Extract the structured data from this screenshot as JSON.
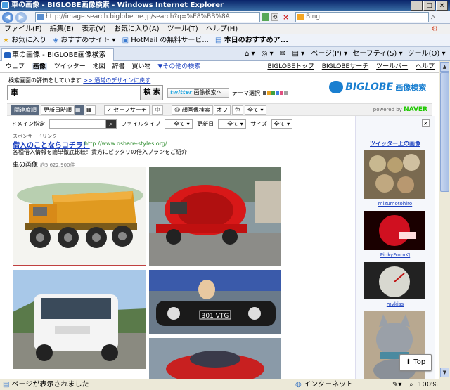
{
  "window": {
    "title": "車の画像 - BIGLOBE画像検索 - Windows Internet Explorer",
    "buttons": [
      "_",
      "□",
      "×"
    ]
  },
  "address": {
    "url": "http://image.search.biglobe.ne.jp/search?q=%E8%BB%8A",
    "search_placeholder": "Bing"
  },
  "menu": [
    "ファイル(F)",
    "編集(E)",
    "表示(V)",
    "お気に入り(A)",
    "ツール(T)",
    "ヘルプ(H)"
  ],
  "favorites": {
    "label": "お気に入り",
    "items": [
      "おすすめサイト ▾",
      "HotMail の無料サービ...",
      "本日のおすすめア..."
    ]
  },
  "tab": {
    "title": "車の画像 - BIGLOBE画像検索",
    "tools": [
      "ページ(P) ▾",
      "セーフティ(S) ▾",
      "ツール(O) ▾"
    ]
  },
  "page": {
    "nav": [
      "ウェブ",
      "画像",
      "ツイッター",
      "地図",
      "辞書",
      "買い物",
      "▼その他の検索"
    ],
    "top_links": [
      "BIGLOBEトップ",
      "BIGLOBEサーチ",
      "ツールバー",
      "ヘルプ"
    ],
    "notice": "検索画面の評価をしています",
    "notice_link": ">> 通常のデザインに戻す",
    "query": "車",
    "search_button": "検 索",
    "twitter_label": "twitter",
    "twitter_suffix": "画像検索へ",
    "theme_label": "テーマ選択",
    "theme_colors": [
      "#555555",
      "#e8a020",
      "#40a040",
      "#4080e0",
      "#e05080",
      "#a0a0a0"
    ],
    "logo": "BIGLOBE",
    "logo_suffix": "画像検索",
    "filters": {
      "relevance": "関連度順",
      "date": "更新日時順",
      "safe": "セーフサーチ",
      "safe_value": "中",
      "face": "顔画像検索",
      "face_value": "オフ",
      "color": "色",
      "color_value": "全て ▾"
    },
    "naver_prefix": "powered by",
    "naver": "NAVER",
    "domain_label": "ドメイン指定",
    "filetype_label": "ファイルタイプ",
    "filetype_value": "全て ▾",
    "updated_label": "更新日",
    "updated_value": "全て ▾",
    "size_label": "サイズ",
    "size_value": "全て ▾",
    "sponsor": "スポンサードリンク",
    "ad_title": "借入のことならコチラ！",
    "ad_url": "http://www.oshare-styles.org/",
    "ad_desc": "各種借入情報を簡単徹底比較！貴方にピッタリの借入プランをご紹介",
    "results_title": "車の画像",
    "results_count": "約5,622,900件",
    "sidebar_title": "ツイッター上の画像",
    "sidebar_users": [
      "mizumotohiro",
      "PinkyFromKJ",
      "mykiss"
    ],
    "top_button": "Top"
  },
  "status": {
    "text": "ページが表示されました",
    "zone": "インターネット",
    "zoom": "100%"
  }
}
